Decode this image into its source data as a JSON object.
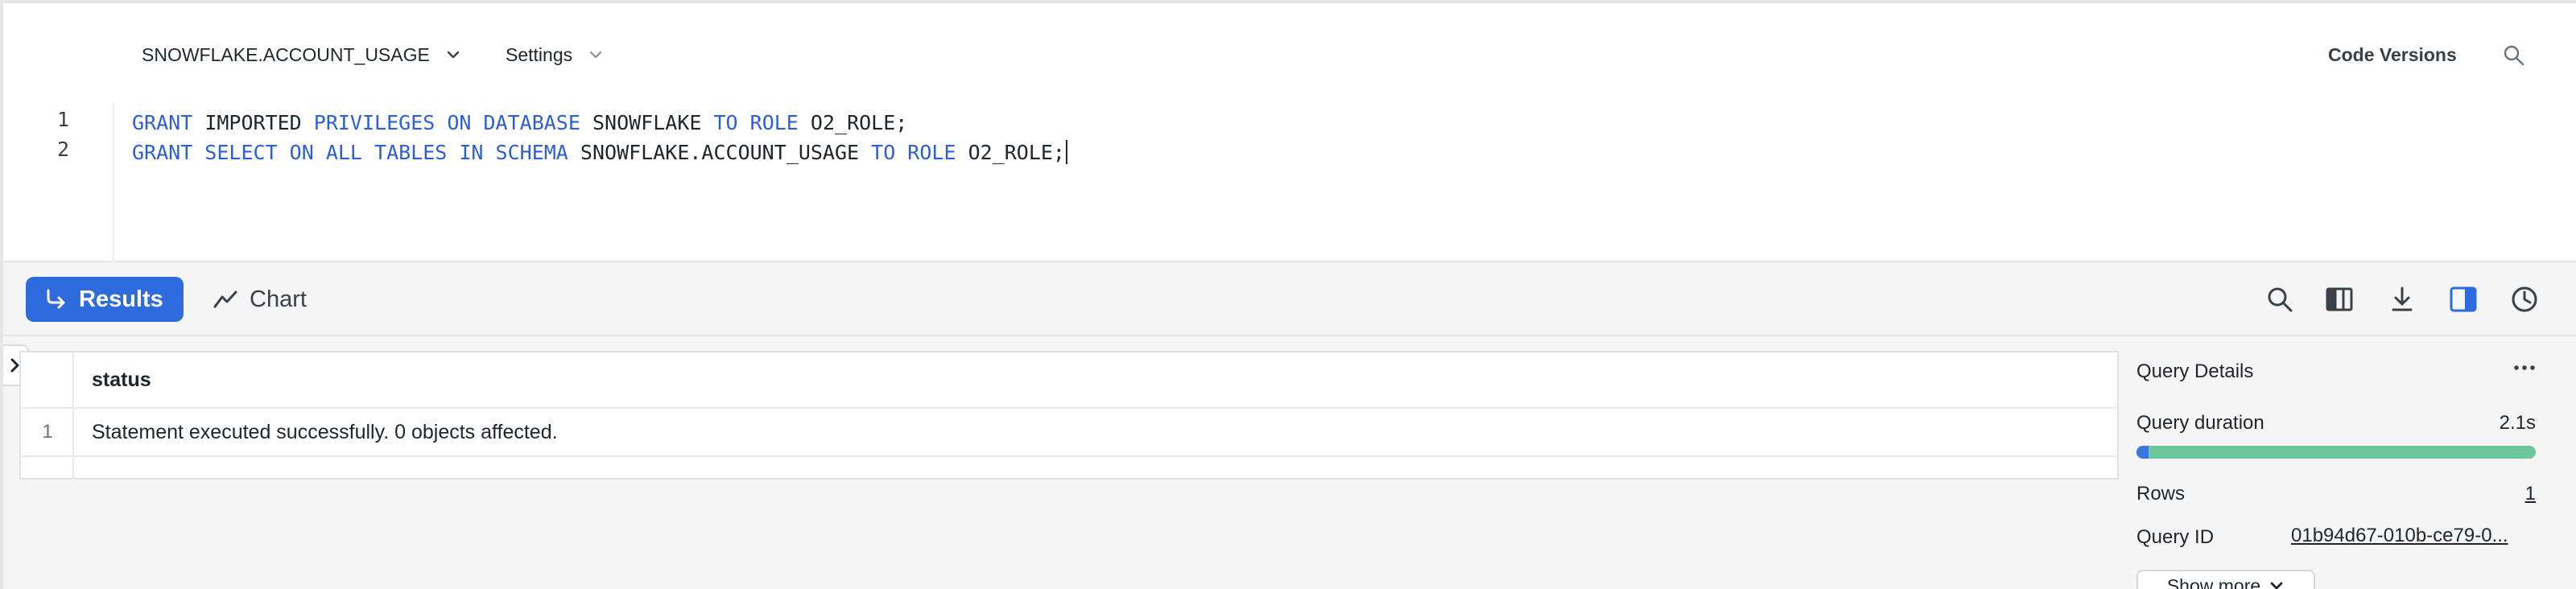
{
  "editor": {
    "database_context": "SNOWFLAKE.ACCOUNT_USAGE",
    "settings_label": "Settings",
    "code_versions_label": "Code Versions",
    "line_numbers": [
      "1",
      "2"
    ],
    "lines": [
      [
        {
          "t": "GRANT",
          "kw": true
        },
        {
          "t": " IMPORTED ",
          "kw": false
        },
        {
          "t": "PRIVILEGES ON DATABASE",
          "kw": true
        },
        {
          "t": " SNOWFLAKE ",
          "kw": false
        },
        {
          "t": "TO ROLE",
          "kw": true
        },
        {
          "t": " O2_ROLE;",
          "kw": false
        }
      ],
      [
        {
          "t": "GRANT SELECT ON ALL TABLES IN SCHEMA",
          "kw": true
        },
        {
          "t": " SNOWFLAKE.ACCOUNT_USAGE ",
          "kw": false
        },
        {
          "t": "TO ROLE",
          "kw": true
        },
        {
          "t": " O2_ROLE;",
          "kw": false
        }
      ]
    ]
  },
  "results_toolbar": {
    "results_tab": "Results",
    "chart_tab": "Chart",
    "active_tab": "Results",
    "accent_color": "#2e6bdc",
    "icons": [
      "search-icon",
      "columns-icon",
      "download-icon",
      "split-panel-icon",
      "history-icon"
    ]
  },
  "grid": {
    "columns": [
      "status"
    ],
    "rows": [
      {
        "index": "1",
        "status": "Statement executed successfully. 0 objects affected."
      }
    ]
  },
  "query_details": {
    "title": "Query Details",
    "duration_label": "Query duration",
    "duration_value": "2.1s",
    "duration_progress_fraction": 0.03,
    "rows_label": "Rows",
    "rows_value": "1",
    "query_id_label": "Query ID",
    "query_id_value": "01b94d67-010b-ce79-0...",
    "show_more_label": "Show more"
  }
}
